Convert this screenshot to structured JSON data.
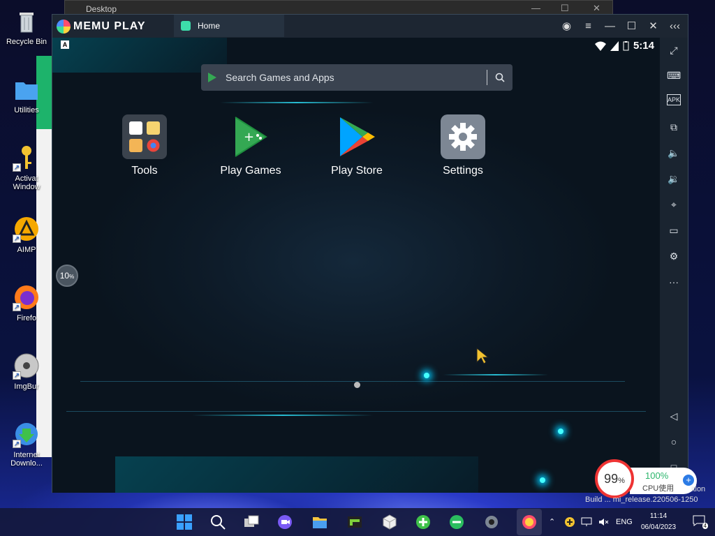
{
  "desktop": {
    "icons": [
      {
        "label": "Recycle Bin"
      },
      {
        "label": "Utilities"
      },
      {
        "label": "Activat Window"
      },
      {
        "label": "AIMP"
      },
      {
        "label": "Firefo"
      },
      {
        "label": "ImgBur"
      },
      {
        "label": "Internet Downlo..."
      }
    ],
    "background_window_title": "Desktop"
  },
  "emulator": {
    "brand": "MEMU PLAY",
    "tab_label": "Home",
    "status_bar": {
      "time": "5:14",
      "left_badge": "A"
    },
    "search": {
      "placeholder": "Search Games and Apps"
    },
    "apps": [
      {
        "label": "Tools"
      },
      {
        "label": "Play Games"
      },
      {
        "label": "Play Store"
      },
      {
        "label": "Settings"
      }
    ],
    "loader": {
      "value": "10",
      "unit": "%"
    },
    "toolbar_icons": [
      "fullscreen-icon",
      "keyboard-icon",
      "apk-icon",
      "multi-window-icon",
      "volume-up-icon",
      "volume-down-icon",
      "location-icon",
      "folder-icon",
      "settings-icon",
      "more-icon",
      "back-icon",
      "home-icon",
      "recents-icon"
    ],
    "apk_label": "APK",
    "more_label": "···"
  },
  "cpu_widget": {
    "memory_percent": "99",
    "memory_unit": "%",
    "cpu_percent": "100%",
    "cpu_label": "CPU使用"
  },
  "overlay": {
    "edition": "ition",
    "build": "Build ... mi_release.220506-1250"
  },
  "taskbar": {
    "language": "ENG",
    "time": "11:14",
    "date": "06/04/2023",
    "notification_count": "4"
  },
  "colors": {
    "emulator_bg": "#0e1a26",
    "titlebar": "#1d2632",
    "accent_glow": "#2fe6ff",
    "taskbar": "#14183c"
  }
}
